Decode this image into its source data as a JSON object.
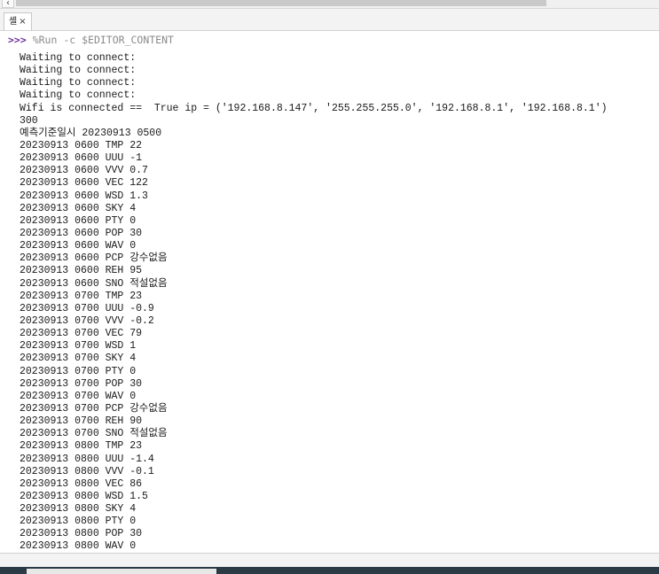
{
  "scrollbar": {
    "left_arrow": "‹"
  },
  "tab": {
    "label": "셸",
    "close": "×"
  },
  "shell": {
    "prompt": ">>>",
    "command": " %Run -c $EDITOR_CONTENT",
    "lines": [
      {
        "text": "Waiting to connect:"
      },
      {
        "text": "Waiting to connect:"
      },
      {
        "text": "Waiting to connect:"
      },
      {
        "text": "Waiting to connect:"
      },
      {
        "text": "Wifi is connected ==  True ip = ('192.168.8.147', '255.255.255.0', '192.168.8.1', '192.168.8.1')"
      },
      {
        "text": "300"
      },
      {
        "text": "예측기준일시 20230913 0500"
      },
      {
        "text": "20230913 0600 TMP 22"
      },
      {
        "text": "20230913 0600 UUU -1"
      },
      {
        "text": "20230913 0600 VVV 0.7"
      },
      {
        "text": "20230913 0600 VEC 122"
      },
      {
        "text": "20230913 0600 WSD 1.3"
      },
      {
        "text": "20230913 0600 SKY 4"
      },
      {
        "text": "20230913 0600 PTY 0"
      },
      {
        "text": "20230913 0600 POP 30"
      },
      {
        "text": "20230913 0600 WAV 0"
      },
      {
        "text": "20230913 0600 PCP 강수없음"
      },
      {
        "text": "20230913 0600 REH 95"
      },
      {
        "text": "20230913 0600 SNO 적설없음"
      },
      {
        "text": "20230913 0700 TMP 23"
      },
      {
        "text": "20230913 0700 UUU -0.9"
      },
      {
        "text": "20230913 0700 VVV -0.2"
      },
      {
        "text": "20230913 0700 VEC 79"
      },
      {
        "text": "20230913 0700 WSD 1"
      },
      {
        "text": "20230913 0700 SKY 4"
      },
      {
        "text": "20230913 0700 PTY 0"
      },
      {
        "text": "20230913 0700 POP 30"
      },
      {
        "text": "20230913 0700 WAV 0"
      },
      {
        "text": "20230913 0700 PCP 강수없음"
      },
      {
        "text": "20230913 0700 REH 90"
      },
      {
        "text": "20230913 0700 SNO 적설없음"
      },
      {
        "text": "20230913 0800 TMP 23"
      },
      {
        "text": "20230913 0800 UUU -1.4"
      },
      {
        "text": "20230913 0800 VVV -0.1"
      },
      {
        "text": "20230913 0800 VEC 86"
      },
      {
        "text": "20230913 0800 WSD 1.5"
      },
      {
        "text": "20230913 0800 SKY 4"
      },
      {
        "text": "20230913 0800 PTY 0"
      },
      {
        "text": "20230913 0800 POP 30"
      },
      {
        "text": "20230913 0800 WAV 0"
      }
    ]
  },
  "colors": {
    "prompt": "#6d2f9c",
    "command": "#8a8a8a",
    "output_text": "#1a1a1a",
    "taskbar": "#2b3a45"
  }
}
